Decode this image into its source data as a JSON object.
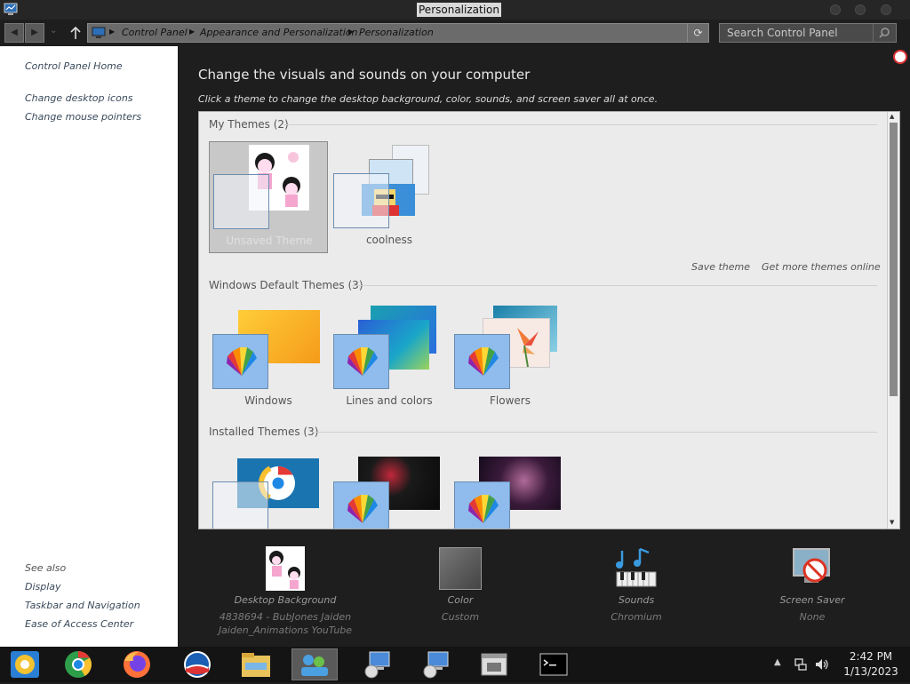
{
  "window": {
    "title": "Personalization"
  },
  "breadcrumb": [
    "Control Panel",
    "Appearance and Personalization",
    "Personalization"
  ],
  "search": {
    "placeholder": "Search Control Panel"
  },
  "sidebar": {
    "home": "Control Panel Home",
    "links": [
      "Change desktop icons",
      "Change mouse pointers"
    ],
    "see_also_label": "See also",
    "see_also": [
      "Display",
      "Taskbar and Navigation",
      "Ease of Access Center"
    ]
  },
  "main": {
    "heading": "Change the visuals and sounds on your computer",
    "subheading": "Click a theme to change the desktop background, color, sounds, and screen saver all at once."
  },
  "themes": {
    "my_themes_title": "My Themes (2)",
    "my_themes": [
      "Unsaved Theme",
      "coolness"
    ],
    "save_theme": "Save theme",
    "get_more": "Get more themes online",
    "default_title": "Windows Default Themes (3)",
    "default_themes": [
      "Windows",
      "Lines and colors",
      "Flowers"
    ],
    "installed_title": "Installed Themes (3)"
  },
  "bottom": {
    "desktop_background": {
      "title": "Desktop Background",
      "sub": "4838694 - BubJones Jaiden Jaiden_Animations YouTube"
    },
    "color": {
      "title": "Color",
      "sub": "Custom"
    },
    "sounds": {
      "title": "Sounds",
      "sub": "Chromium"
    },
    "screen_saver": {
      "title": "Screen Saver",
      "sub": "None"
    }
  },
  "taskbar": {
    "apps": [
      "chromium-icon",
      "chrome-icon",
      "firefox-icon",
      "obama-logo-icon",
      "file-explorer-icon",
      "personalization-icon",
      "remote-desktop-icon",
      "remote-desktop-icon",
      "app-window-icon",
      "terminal-icon"
    ],
    "time": "2:42 PM",
    "date": "1/13/2023"
  },
  "colors": {
    "accent": "#8fbcec",
    "panel": "#ebebeb",
    "background": "#1e1e1e"
  }
}
